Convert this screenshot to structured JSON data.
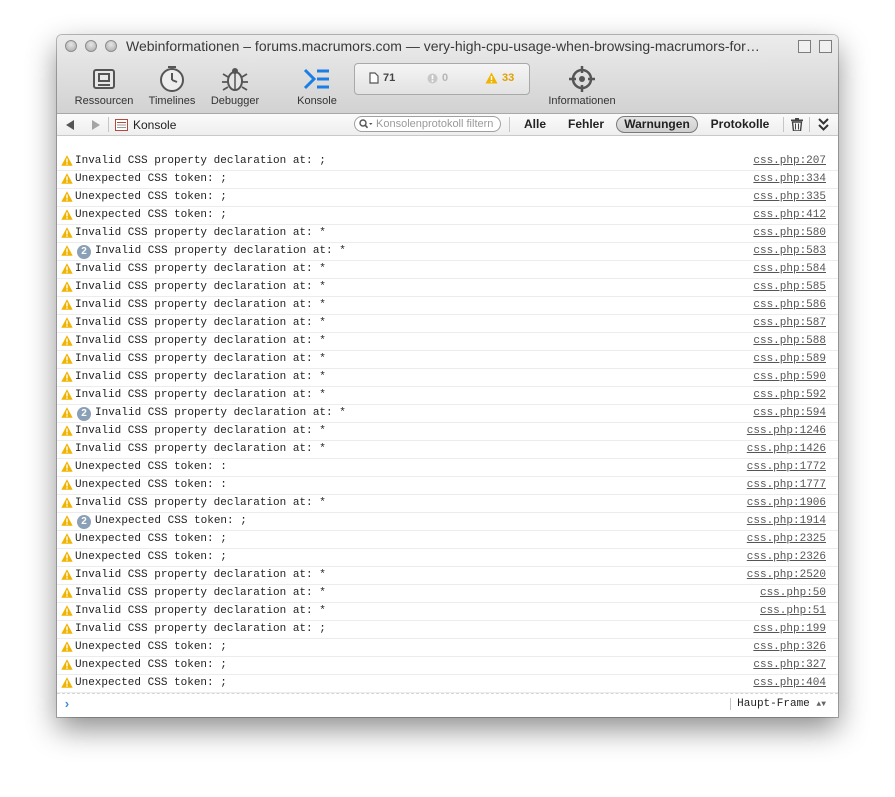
{
  "window": {
    "title": "Webinformationen – forums.macrumors.com — very-high-cpu-usage-when-browsing-macrumors-for…"
  },
  "toolbar": {
    "tools": [
      {
        "label": "Ressourcen",
        "icon": "resources-icon"
      },
      {
        "label": "Timelines",
        "icon": "timelines-icon"
      },
      {
        "label": "Debugger",
        "icon": "debugger-icon"
      },
      {
        "label": "Konsole",
        "icon": "console-icon"
      },
      {
        "label": "Informationen",
        "icon": "crosshair-icon"
      }
    ],
    "dashboard": {
      "resources": "71",
      "errors": "0",
      "warnings": "33"
    }
  },
  "filterbar": {
    "breadcrumb": "Konsole",
    "search_placeholder": "Konsolenprotokoll filtern",
    "filters": [
      "Alle",
      "Fehler",
      "Warnungen",
      "Protokolle"
    ],
    "active_filter": "Warnungen"
  },
  "colors": {
    "warning": "#f0b400",
    "badge": "#8aa0b6",
    "accent": "#3c8de0"
  },
  "messages": [
    {
      "text": "Invalid CSS property declaration at: ;",
      "source": "css.php:207",
      "count": ""
    },
    {
      "text": "Unexpected CSS token: ;",
      "source": "css.php:334",
      "count": ""
    },
    {
      "text": "Unexpected CSS token: ;",
      "source": "css.php:335",
      "count": ""
    },
    {
      "text": "Unexpected CSS token: ;",
      "source": "css.php:412",
      "count": ""
    },
    {
      "text": "Invalid CSS property declaration at: *",
      "source": "css.php:580",
      "count": ""
    },
    {
      "text": "Invalid CSS property declaration at: *",
      "source": "css.php:583",
      "count": "2"
    },
    {
      "text": "Invalid CSS property declaration at: *",
      "source": "css.php:584",
      "count": ""
    },
    {
      "text": "Invalid CSS property declaration at: *",
      "source": "css.php:585",
      "count": ""
    },
    {
      "text": "Invalid CSS property declaration at: *",
      "source": "css.php:586",
      "count": ""
    },
    {
      "text": "Invalid CSS property declaration at: *",
      "source": "css.php:587",
      "count": ""
    },
    {
      "text": "Invalid CSS property declaration at: *",
      "source": "css.php:588",
      "count": ""
    },
    {
      "text": "Invalid CSS property declaration at: *",
      "source": "css.php:589",
      "count": ""
    },
    {
      "text": "Invalid CSS property declaration at: *",
      "source": "css.php:590",
      "count": ""
    },
    {
      "text": "Invalid CSS property declaration at: *",
      "source": "css.php:592",
      "count": ""
    },
    {
      "text": "Invalid CSS property declaration at: *",
      "source": "css.php:594",
      "count": "2"
    },
    {
      "text": "Invalid CSS property declaration at: *",
      "source": "css.php:1246",
      "count": ""
    },
    {
      "text": "Invalid CSS property declaration at: *",
      "source": "css.php:1426",
      "count": ""
    },
    {
      "text": "Unexpected CSS token: :",
      "source": "css.php:1772",
      "count": ""
    },
    {
      "text": "Unexpected CSS token: :",
      "source": "css.php:1777",
      "count": ""
    },
    {
      "text": "Invalid CSS property declaration at: *",
      "source": "css.php:1906",
      "count": ""
    },
    {
      "text": "Unexpected CSS token: ;",
      "source": "css.php:1914",
      "count": "2"
    },
    {
      "text": "Unexpected CSS token: ;",
      "source": "css.php:2325",
      "count": ""
    },
    {
      "text": "Unexpected CSS token: ;",
      "source": "css.php:2326",
      "count": ""
    },
    {
      "text": "Invalid CSS property declaration at: *",
      "source": "css.php:2520",
      "count": ""
    },
    {
      "text": "Invalid CSS property declaration at: *",
      "source": "css.php:50",
      "count": ""
    },
    {
      "text": "Invalid CSS property declaration at: *",
      "source": "css.php:51",
      "count": ""
    },
    {
      "text": "Invalid CSS property declaration at: ;",
      "source": "css.php:199",
      "count": ""
    },
    {
      "text": "Unexpected CSS token: ;",
      "source": "css.php:326",
      "count": ""
    },
    {
      "text": "Unexpected CSS token: ;",
      "source": "css.php:327",
      "count": ""
    },
    {
      "text": "Unexpected CSS token: ;",
      "source": "css.php:404",
      "count": ""
    }
  ],
  "prompt": {
    "frame_label": "Haupt-Frame"
  }
}
